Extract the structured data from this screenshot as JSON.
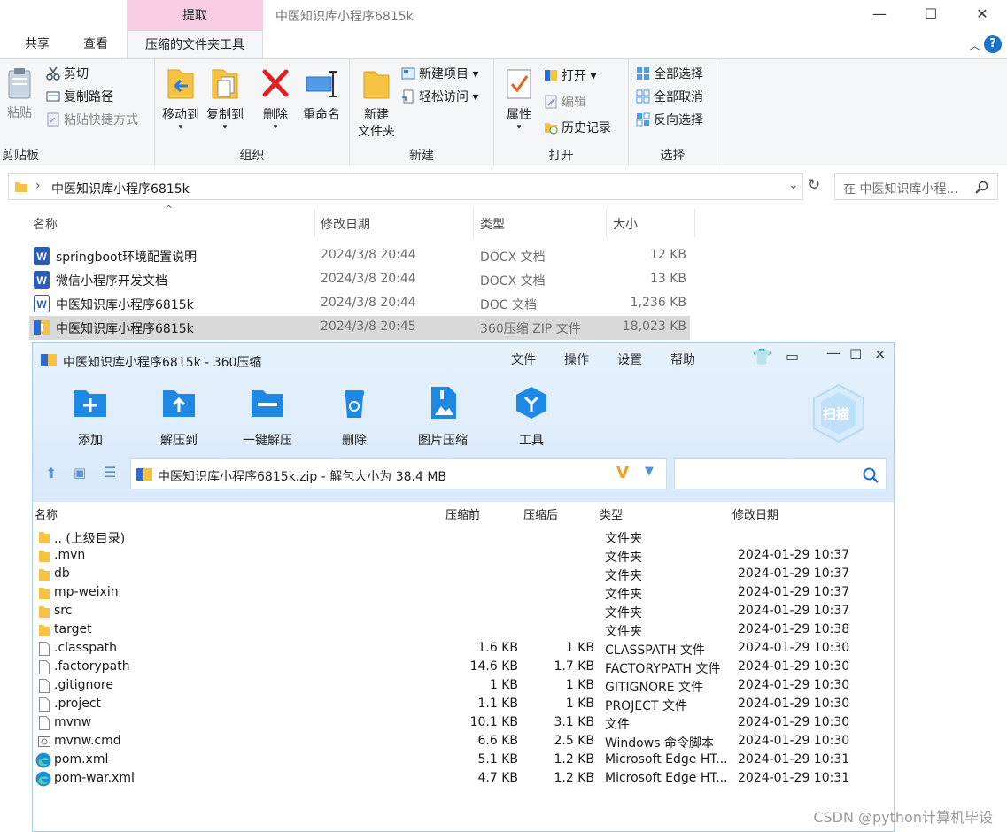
{
  "window": {
    "context_tab": "提取",
    "title": "中医知识库小程序6815k",
    "minimize": "—",
    "maximize": "☐",
    "close": "✕"
  },
  "ribbon_tabs": [
    "共享",
    "查看",
    "压缩的文件夹工具"
  ],
  "ribbon": {
    "clipboard": {
      "paste": "粘贴",
      "cut": "剪切",
      "copy_path": "复制路径",
      "paste_shortcut": "粘贴快捷方式",
      "label": "剪贴板"
    },
    "organize": {
      "move_to": "移动到",
      "copy_to": "复制到",
      "delete": "删除",
      "rename": "重命名",
      "label": "组织"
    },
    "new": {
      "new_folder_l1": "新建",
      "new_folder_l2": "文件夹",
      "new_item": "新建项目",
      "easy_access": "轻松访问",
      "label": "新建"
    },
    "open": {
      "properties": "属性",
      "open": "打开",
      "edit": "编辑",
      "history": "历史记录",
      "label": "打开"
    },
    "select": {
      "select_all": "全部选择",
      "select_none": "全部取消",
      "invert": "反向选择",
      "label": "选择"
    }
  },
  "address": {
    "path": "中医知识库小程序6815k",
    "search_placeholder": "在 中医知识库小程..."
  },
  "explorer_columns": [
    "名称",
    "修改日期",
    "类型",
    "大小"
  ],
  "explorer_files": [
    {
      "name": "springboot环境配置说明",
      "date": "2024/3/8 20:44",
      "type": "DOCX 文档",
      "size": "12 KB"
    },
    {
      "name": "微信小程序开发文档",
      "date": "2024/3/8 20:44",
      "type": "DOCX 文档",
      "size": "13 KB"
    },
    {
      "name": "中医知识库小程序6815k",
      "date": "2024/3/8 20:44",
      "type": "DOC 文档",
      "size": "1,236 KB"
    },
    {
      "name": "中医知识库小程序6815k",
      "date": "2024/3/8 20:45",
      "type": "360压缩 ZIP 文件",
      "size": "18,023 KB"
    }
  ],
  "zip": {
    "title": "中医知识库小程序6815k - 360压缩",
    "menu": [
      "文件",
      "操作",
      "设置",
      "帮助"
    ],
    "tools": [
      "添加",
      "解压到",
      "一键解压",
      "删除",
      "图片压缩",
      "工具"
    ],
    "scan": "扫描",
    "address": "中医知识库小程序6815k.zip - 解包大小为 38.4 MB",
    "columns": [
      "名称",
      "压缩前",
      "压缩后",
      "类型",
      "修改日期"
    ],
    "rows": [
      {
        "name": ".. (上级目录)",
        "before": "",
        "after": "",
        "type": "文件夹",
        "date": "",
        "kind": "folder"
      },
      {
        "name": ".mvn",
        "before": "",
        "after": "",
        "type": "文件夹",
        "date": "2024-01-29 10:37",
        "kind": "folder"
      },
      {
        "name": "db",
        "before": "",
        "after": "",
        "type": "文件夹",
        "date": "2024-01-29 10:37",
        "kind": "folder"
      },
      {
        "name": "mp-weixin",
        "before": "",
        "after": "",
        "type": "文件夹",
        "date": "2024-01-29 10:37",
        "kind": "folder"
      },
      {
        "name": "src",
        "before": "",
        "after": "",
        "type": "文件夹",
        "date": "2024-01-29 10:37",
        "kind": "folder"
      },
      {
        "name": "target",
        "before": "",
        "after": "",
        "type": "文件夹",
        "date": "2024-01-29 10:38",
        "kind": "folder"
      },
      {
        "name": ".classpath",
        "before": "1.6 KB",
        "after": "1 KB",
        "type": "CLASSPATH 文件",
        "date": "2024-01-29 10:30",
        "kind": "file"
      },
      {
        "name": ".factorypath",
        "before": "14.6 KB",
        "after": "1.7 KB",
        "type": "FACTORYPATH 文件",
        "date": "2024-01-29 10:30",
        "kind": "file"
      },
      {
        "name": ".gitignore",
        "before": "1 KB",
        "after": "1 KB",
        "type": "GITIGNORE 文件",
        "date": "2024-01-29 10:30",
        "kind": "file"
      },
      {
        "name": ".project",
        "before": "1.1 KB",
        "after": "1 KB",
        "type": "PROJECT 文件",
        "date": "2024-01-29 10:30",
        "kind": "file"
      },
      {
        "name": "mvnw",
        "before": "10.1 KB",
        "after": "3.1 KB",
        "type": "文件",
        "date": "2024-01-29 10:30",
        "kind": "file"
      },
      {
        "name": "mvnw.cmd",
        "before": "6.6 KB",
        "after": "2.5 KB",
        "type": "Windows 命令脚本",
        "date": "2024-01-29 10:30",
        "kind": "cmd"
      },
      {
        "name": "pom.xml",
        "before": "5.1 KB",
        "after": "1.2 KB",
        "type": "Microsoft Edge HT...",
        "date": "2024-01-29 10:31",
        "kind": "edge"
      },
      {
        "name": "pom-war.xml",
        "before": "4.7 KB",
        "after": "1.2 KB",
        "type": "Microsoft Edge HT...",
        "date": "2024-01-29 10:31",
        "kind": "edge"
      }
    ]
  },
  "watermark": "CSDN @python计算机毕设",
  "colors": {
    "accent_pink": "#f8cde4",
    "zip_blue": "#1e88e5",
    "word_blue": "#2b5cb8",
    "folder_yellow": "#f5c242"
  }
}
